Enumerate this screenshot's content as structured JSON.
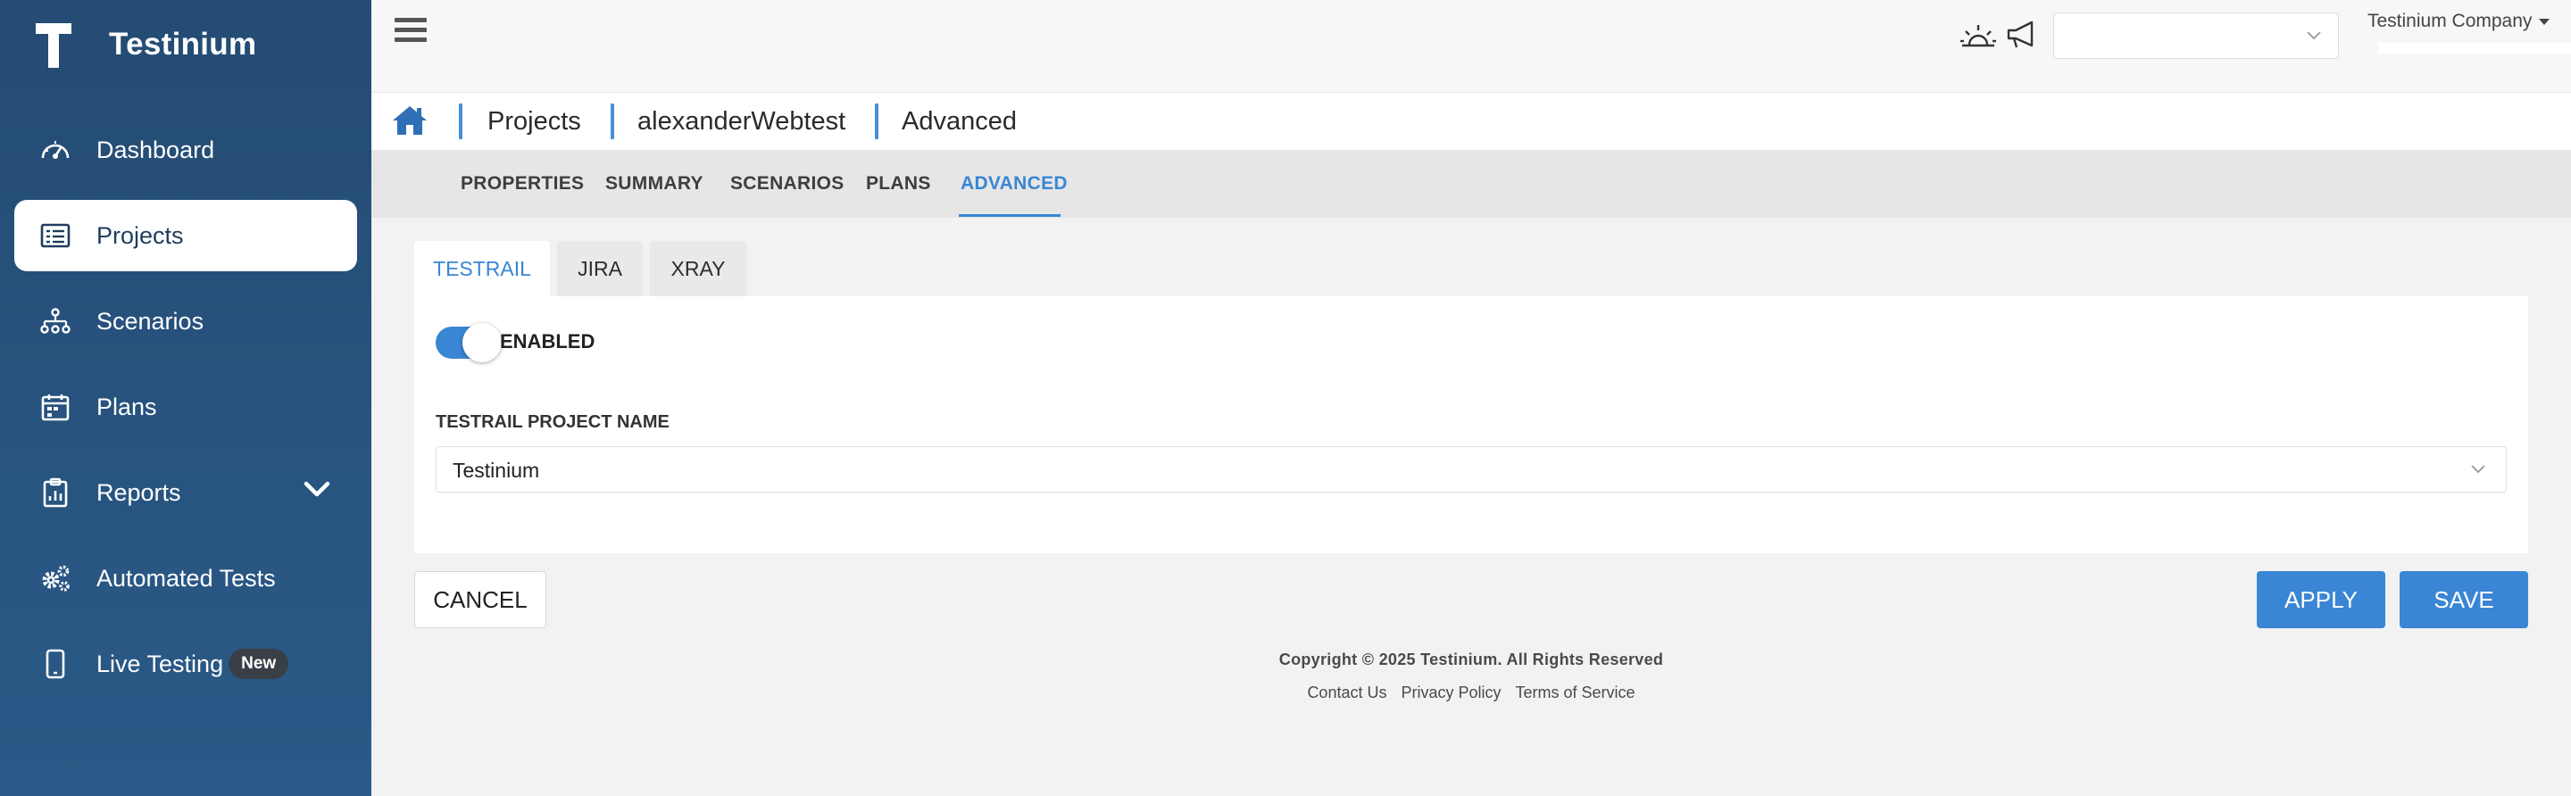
{
  "brand": {
    "name": "Testinium"
  },
  "sidebar": {
    "items": [
      {
        "label": "Dashboard",
        "icon": "gauge-icon"
      },
      {
        "label": "Projects",
        "icon": "projects-icon",
        "active": true
      },
      {
        "label": "Scenarios",
        "icon": "sitemap-icon"
      },
      {
        "label": "Plans",
        "icon": "calendar-icon"
      },
      {
        "label": "Reports",
        "icon": "report-icon",
        "expandable": true
      },
      {
        "label": "Automated Tests",
        "icon": "gears-icon"
      },
      {
        "label": "Live Testing",
        "icon": "mobile-icon",
        "badge": "New"
      }
    ]
  },
  "topbar": {
    "select_value": "",
    "company": "Testinium Company",
    "icons": [
      "sun-icon",
      "megaphone-icon"
    ]
  },
  "breadcrumb": {
    "items": [
      "Projects",
      "alexanderWebtest",
      "Advanced"
    ]
  },
  "tabs": {
    "items": [
      "PROPERTIES",
      "SUMMARY",
      "SCENARIOS",
      "PLANS",
      "ADVANCED"
    ],
    "active": "ADVANCED"
  },
  "subtabs": {
    "items": [
      "TESTRAIL",
      "JIRA",
      "XRAY"
    ],
    "active": "TESTRAIL"
  },
  "testrail": {
    "toggle_label": "ENABLED",
    "toggle_on": true,
    "project_label": "TESTRAIL PROJECT NAME",
    "project_value": "Testinium"
  },
  "actions": {
    "cancel": "CANCEL",
    "apply": "APPLY",
    "save": "SAVE"
  },
  "footer": {
    "copyright": "Copyright © 2025 Testinium. All Rights Reserved",
    "links": [
      "Contact Us",
      "Privacy Policy",
      "Terms of Service"
    ]
  },
  "colors": {
    "sidebar": "#2b5a88",
    "accent": "#3a86d4",
    "tabs_bg": "#e6e6e6",
    "content_bg": "#f2f2f2"
  }
}
